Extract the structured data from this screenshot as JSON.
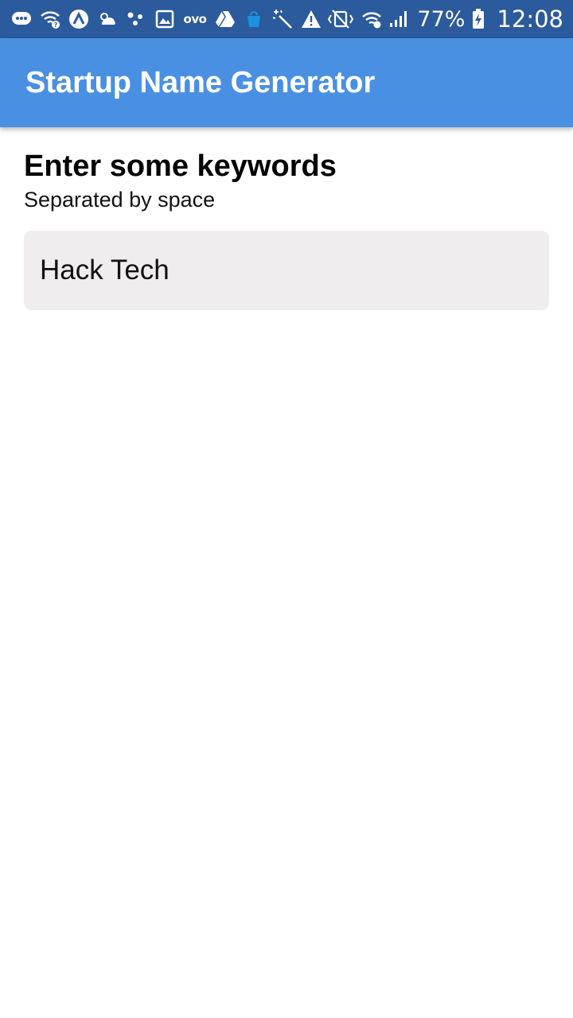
{
  "status_bar": {
    "left_icons": [
      "message-icon",
      "wifi-question-icon",
      "arrow-up-circle-icon",
      "cloudy-sun-icon",
      "dots-icon",
      "image-icon",
      "ovo-icon",
      "drive-icon",
      "bag-icon",
      "magic-wand-icon",
      "warning-icon"
    ],
    "ovo_label": "ovo",
    "battery_percent": "77%",
    "time": "12:08",
    "background_color": "#2b5a9d"
  },
  "app_bar": {
    "title": "Startup Name Generator",
    "background_color": "#4a90e2"
  },
  "form": {
    "heading": "Enter some keywords",
    "subheading": "Separated by space",
    "keywords_value": "Hack Tech"
  }
}
